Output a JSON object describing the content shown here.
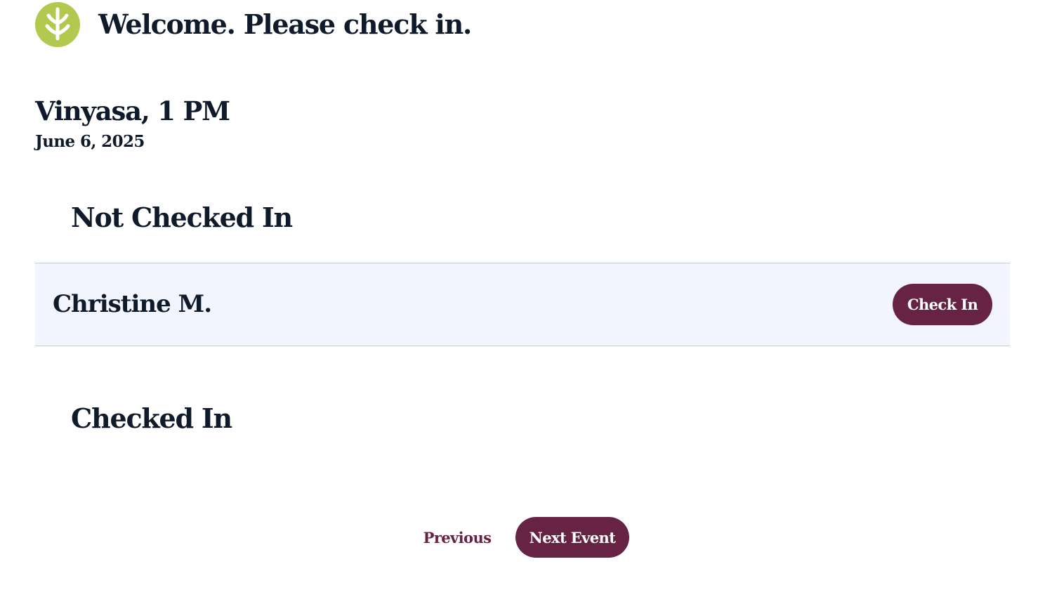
{
  "header": {
    "logo_icon": "sprout-leaf-icon",
    "logo_color": "#b1c94e",
    "welcome_text": "Welcome. Please check in."
  },
  "event": {
    "title": "Vinyasa, 1 PM",
    "date": "June 6, 2025"
  },
  "not_checked_in": {
    "heading": "Not Checked In",
    "attendees": [
      {
        "name": "Christine M.",
        "action_label": "Check In"
      }
    ]
  },
  "checked_in": {
    "heading": "Checked In",
    "attendees": []
  },
  "navigation": {
    "previous_label": "Previous",
    "next_label": "Next Event"
  },
  "colors": {
    "accent": "#662343",
    "text": "#0f1a2b",
    "row_background": "#f2f5fd",
    "row_border": "#c8cad2"
  }
}
